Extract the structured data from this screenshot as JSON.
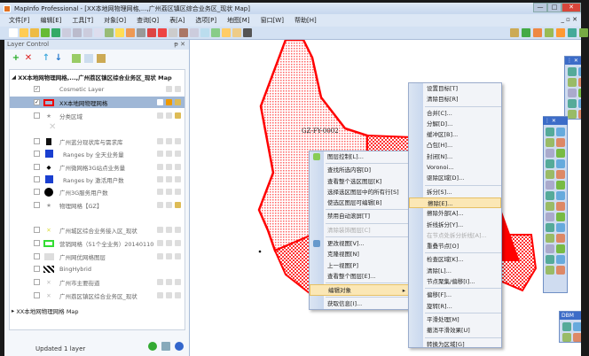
{
  "window": {
    "title": "MapInfo Professional - [XX本地网物理网格,...,广州荔区镇区综合业务区_现状 Map]",
    "min": "—",
    "max": "□",
    "close": "✕"
  },
  "menu": [
    "文件[F]",
    "编辑[E]",
    "工具[T]",
    "对象[O]",
    "查询[Q]",
    "表[A]",
    "选项[P]",
    "地图[M]",
    "窗口[W]",
    "帮助[H]"
  ],
  "mdi_controls": "_ ▫ ✕",
  "layer_control": {
    "title": "Layer Control",
    "pin": "ᵽ ✕",
    "map1": "XX本地网物理网格,...,广州荔区镇区综合业务区_现状 Map",
    "layers": [
      {
        "name": "Cosmetic Layer",
        "checked": true
      },
      {
        "name": "XX本地网物理网格",
        "checked": true,
        "selected": true
      },
      {
        "name": "分类区域",
        "checked": false
      },
      {
        "name": "广州蓝分现状库与需求库",
        "checked": false
      },
      {
        "name": "Ranges by 全天业务量",
        "checked": false
      },
      {
        "name": "广州微网格3G站点业务量",
        "checked": false
      },
      {
        "name": "Ranges by 激活用户数",
        "checked": false
      },
      {
        "name": "广州3G服务用户数",
        "checked": false
      },
      {
        "name": "物理网格【GZ】",
        "checked": false
      },
      {
        "name": "广州城区综合业务接入区_现状",
        "checked": false
      },
      {
        "name": "营销网格（51个全业务）20140110",
        "checked": false
      },
      {
        "name": "广州网优网格图层",
        "checked": false
      },
      {
        "name": "BingHybrid",
        "checked": false
      },
      {
        "name": "广州市主要街道",
        "checked": false
      },
      {
        "name": "广州荔区镇区综合业务区_现状",
        "checked": false
      }
    ],
    "map2": "XX本地网物理网格 Map",
    "status": "Updated 1 layer"
  },
  "map": {
    "label": "GZ-FY-0002"
  },
  "context_menu": [
    {
      "label": "图层控制[L]...",
      "icon": "layers-icon"
    },
    {
      "sep": true
    },
    {
      "label": "查找所选内容[D]"
    },
    {
      "label": "查看整个选区图层[K]"
    },
    {
      "label": "选择选区图层中的所有行[S]"
    },
    {
      "label": "使选区图层可编辑[B]"
    },
    {
      "sep": true
    },
    {
      "label": "禁用自动滚屏[T]"
    },
    {
      "sep": true
    },
    {
      "label": "清除装饰图层[C]",
      "disabled": true
    },
    {
      "sep": true
    },
    {
      "label": "更改视图[V]...",
      "icon": "zoom-icon"
    },
    {
      "label": "克隆视图[N]"
    },
    {
      "label": "上一视图[P]"
    },
    {
      "label": "查看整个图层[E]..."
    },
    {
      "sep": true
    },
    {
      "label": "编辑对象",
      "highlight": true,
      "submenu": true
    },
    {
      "sep": true
    },
    {
      "label": "获取信息[I]..."
    }
  ],
  "submenu": [
    {
      "label": "设置目标[T]"
    },
    {
      "label": "清除目标[R]"
    },
    {
      "sep": true
    },
    {
      "label": "合并[C]..."
    },
    {
      "label": "分解[D]..."
    },
    {
      "label": "缓冲区[B]..."
    },
    {
      "label": "凸包[H]..."
    },
    {
      "label": "封闭[N]..."
    },
    {
      "label": "Voronoi..."
    },
    {
      "label": "驱除区域[D]..."
    },
    {
      "sep": true
    },
    {
      "label": "拆分[S]..."
    },
    {
      "label": "擦除[E]...",
      "highlight": true
    },
    {
      "label": "擦除外部[A]..."
    },
    {
      "label": "折线拆分[Y]..."
    },
    {
      "label": "在节点处拆分折线[A]...",
      "disabled": true
    },
    {
      "label": "重叠节点[O]"
    },
    {
      "sep": true
    },
    {
      "label": "检查区域[K]..."
    },
    {
      "label": "清除[L]..."
    },
    {
      "label": "节点聚集/偏移[I]..."
    },
    {
      "sep": true
    },
    {
      "label": "偏移[F]..."
    },
    {
      "label": "旋转[R]..."
    },
    {
      "sep": true
    },
    {
      "label": "平滑处理[M]"
    },
    {
      "label": "撤消平滑效果[U]"
    },
    {
      "sep": true
    },
    {
      "label": "转换为区域[G]"
    }
  ],
  "dbm": {
    "title": "DBM"
  },
  "colors": {
    "accent": "#ff0000",
    "menu_highlight": "#fbe7b5"
  }
}
